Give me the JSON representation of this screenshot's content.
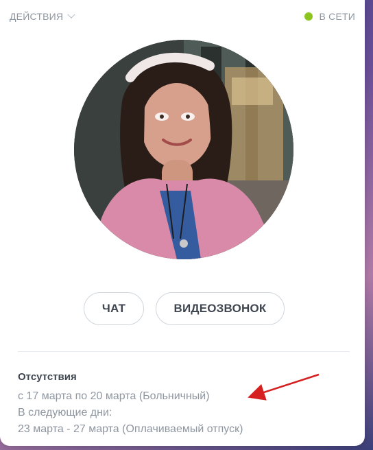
{
  "header": {
    "actions_label": "ДЕЙСТВИЯ",
    "status_label": "В СЕТИ",
    "status_color": "#8cc520"
  },
  "profile": {
    "avatar_alt": "avatar"
  },
  "buttons": {
    "chat_label": "ЧАТ",
    "video_label": "ВИДЕОЗВОНОК"
  },
  "absence": {
    "title": "Отсутствия",
    "line1": "с 17 марта по 20 марта (Больничный)",
    "line2": "В следующие дни:",
    "line3": "23 марта - 27 марта (Оплачиваемый отпуск)"
  },
  "annotation": {
    "arrow_color": "#d61f1f"
  }
}
